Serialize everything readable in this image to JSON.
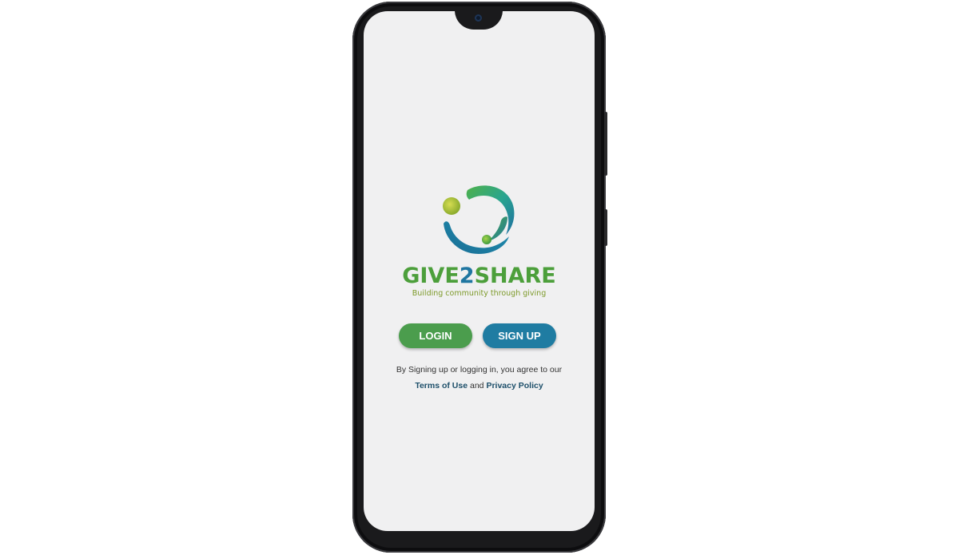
{
  "brand": {
    "name_part1": "GIVE",
    "name_part2": "2",
    "name_part3": "SHARE",
    "tagline": "Building community through giving"
  },
  "actions": {
    "login_label": "LOGIN",
    "signup_label": "SIGN UP"
  },
  "legal": {
    "line1": "By Signing up or logging in, you agree to our",
    "terms_label": "Terms of Use",
    "conjunction": "and",
    "privacy_label": "Privacy Policy"
  },
  "colors": {
    "screen_bg": "#f0f0f1",
    "brand_green": "#4c9f3b",
    "brand_blue": "#1f76a1",
    "login_button": "#4b9d4d",
    "signup_button": "#1f7ca2",
    "tagline": "#7d9a2a",
    "link": "#1d4f6a"
  },
  "icons": {
    "logo": "give2share-logo-icon",
    "camera": "front-camera-icon"
  }
}
